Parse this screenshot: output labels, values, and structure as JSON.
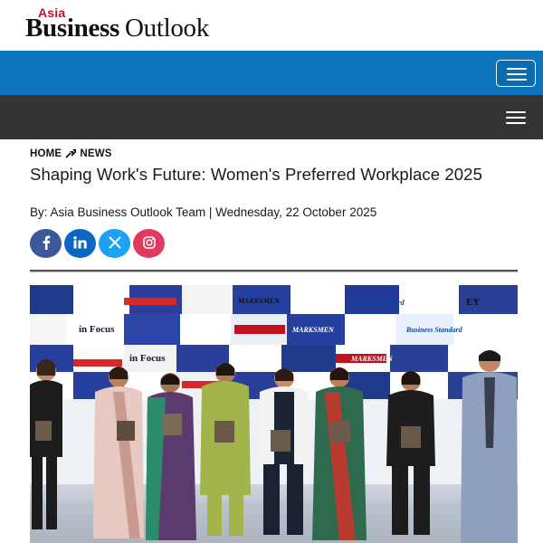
{
  "site": {
    "logo_small": "Asia",
    "logo_word1": "Business",
    "logo_word2": "Outlook"
  },
  "colors": {
    "blue_nav": "#0a75bd",
    "dark_nav": "#343434",
    "logo_accent": "#c8102e",
    "facebook": "#3b5998",
    "linkedin": "#0a66c2",
    "twitter": "#1da1f2",
    "instagram": "#e03a5e"
  },
  "nav": {
    "primary_menu_icon": "hamburger-icon",
    "secondary_menu_icon": "hamburger-icon"
  },
  "breadcrumb": {
    "home": "HOME",
    "separator_icon": "arrows-icon",
    "section": "NEWS"
  },
  "article": {
    "title": "Shaping Work's Future: Women's Preferred Workplace 2025",
    "byline": "By: Asia Business Outlook Team | Wednesday, 22 October 2025"
  },
  "share": {
    "facebook_icon": "facebook-icon",
    "linkedin_icon": "linkedin-icon",
    "x_icon": "x-icon",
    "instagram_icon": "instagram-icon"
  },
  "hero_image": {
    "backdrop_logos": [
      "in Focus",
      "MARKSMEN",
      "Business Standard",
      "EY",
      "TEAM MARKSMEN"
    ]
  }
}
